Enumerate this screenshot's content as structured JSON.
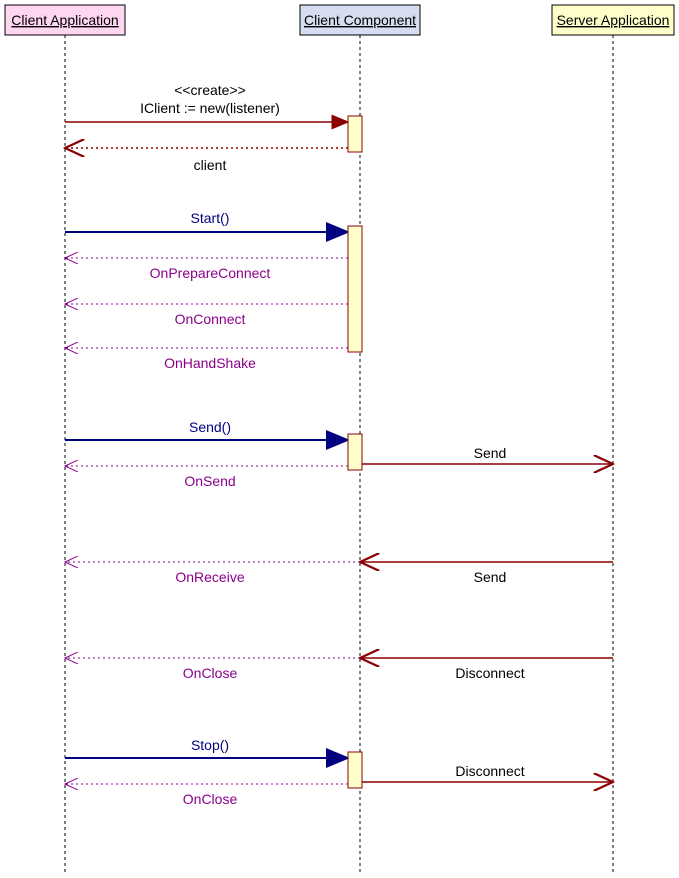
{
  "participants": {
    "clientApp": {
      "label": "Client Application",
      "fill": "#FFD6F0"
    },
    "clientComp": {
      "label": "Client Component",
      "fill": "#D6DDF0"
    },
    "serverApp": {
      "label": "Server Application",
      "fill": "#FFFFCC"
    }
  },
  "messages": {
    "create_stereo": "<<create>>",
    "create_call": "IClient := new(listener)",
    "create_ret": "client",
    "start": "Start()",
    "onPrepare": "OnPrepareConnect",
    "onConnect": "OnConnect",
    "onHandshake": "OnHandShake",
    "send": "Send()",
    "sendNet1": "Send",
    "onSend": "OnSend",
    "sendNet2": "Send",
    "onReceive": "OnReceive",
    "disconnect1": "Disconnect",
    "onClose1": "OnClose",
    "stop": "Stop()",
    "disconnect2": "Disconnect",
    "onClose2": "OnClose"
  }
}
